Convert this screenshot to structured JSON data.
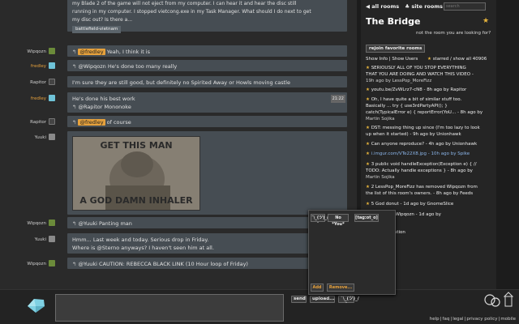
{
  "messages": [
    {
      "user": "",
      "text_line1": "my Blade 2 of the game will not eject from my computer. I can hear it and hear the disc still",
      "text_line2": "running in my computer. I stopped vietcong.exe in my Task Manager. What should I do next to get",
      "text_line3": "my disc out? Is there a...",
      "tag": "battlefield-vietnam"
    },
    {
      "user": "Wipqozn",
      "mention": "@fredley",
      "text": "Yeah, I think it is"
    },
    {
      "user": "fredley",
      "text": "@Wipqozn He's done too many really"
    },
    {
      "user": "Rapitor",
      "text": "I'm sure they are still good, but definitely no Spirited Away or Howls moving castle"
    },
    {
      "user": "fredley",
      "line1": "He's done his best work",
      "line2": "@Rapitor Mononoke",
      "time": "21:22"
    },
    {
      "user": "Rapitor",
      "mention": "@fredley",
      "text": "of course"
    },
    {
      "user": "Yuuki",
      "image_top": "GET THIS MAN",
      "image_bottom": "A GOD DAMN INHALER"
    },
    {
      "user": "Wipqozn",
      "text": "@Yuuki Panting man"
    },
    {
      "user": "Yuuki",
      "line1": "Hmm... Last week and today. Serious drop in Friday.",
      "line2": "Where is @Sterno anyways? I haven't seen him at all."
    },
    {
      "user": "Wipqozn",
      "text": "@Yuuki CAUTION: REBECCA BLACK LINK (10 Hour loop of Friday)"
    }
  ],
  "input": {
    "placeholder": "",
    "value": ""
  },
  "buttons": {
    "send": "send",
    "upload": "upload...",
    "ascii": "¯\\_(ツ)_/¯"
  },
  "footer": {
    "links": [
      "help",
      "faq",
      "legal",
      "privacy policy",
      "mobile"
    ]
  },
  "sidebar": {
    "all_rooms": "all rooms",
    "site_rooms": "site rooms",
    "search_placeholder": "search",
    "room_title": "The Bridge",
    "room_desc": "not the room you are looking for?",
    "rejoin": "rejoin favorite rooms",
    "show_info": "Show Info | Show Users",
    "starred": "starred / show all 40906",
    "starred_items": [
      {
        "lines": [
          "SERIOUSLY ALL OF YOU STOP EVERYTHING",
          "THAT YOU ARE DOING AND WATCH THIS VIDEO -",
          "19h ago by LessPop_MoreFizz"
        ]
      },
      {
        "lines": [
          "youtu.be/ZvWLrz7-cN8 - 8h ago by Rapitor"
        ]
      },
      {
        "lines": [
          "Oh, I have quite a bit of similar stuff too.",
          "Basically ... try { use3rdPartyAPI(); }",
          "catch(TypicalError e) { reportError(YoU... - 8h ago by",
          "Martin Sojika"
        ]
      },
      {
        "lines": [
          "DST: messing thing up since (I'm too lazy to look",
          "up when it started) - 9h ago by Unionhawk"
        ]
      },
      {
        "lines": [
          "Can anyone reproduce? - 4h ago by Unionhawk"
        ]
      },
      {
        "lines": [
          "i.imgur.com/VTe22X8.jpg - 10h ago by Spike"
        ]
      },
      {
        "lines": [
          "3 public void handleException(Exception e) { //",
          "TODO: Actually handle exceptions } - 8h ago by",
          "Martin Sojika"
        ]
      },
      {
        "lines": [
          "2 LessPop_MoreFizz has removed Wipqozn from",
          "the list of this room's owners. - 8h ago by Feeds"
        ]
      },
      {
        "lines": [
          "5 God donut - 1d ago by GnomeSlice"
        ]
      },
      {
        "lines": [
          "the fuck @Wipqozn - 1d ago by"
        ]
      }
    ],
    "notif_fragment": "ktop notification"
  },
  "popup": {
    "ascii": "¯\\_(ツ)_/¯",
    "no_you": "No *You*",
    "tagout": "[tag:ot_o]",
    "add": "Add",
    "remove": "Remove..."
  },
  "colors": {
    "accent": "#e6a13c",
    "bubble": "#464d53",
    "star": "#e6b43c"
  }
}
